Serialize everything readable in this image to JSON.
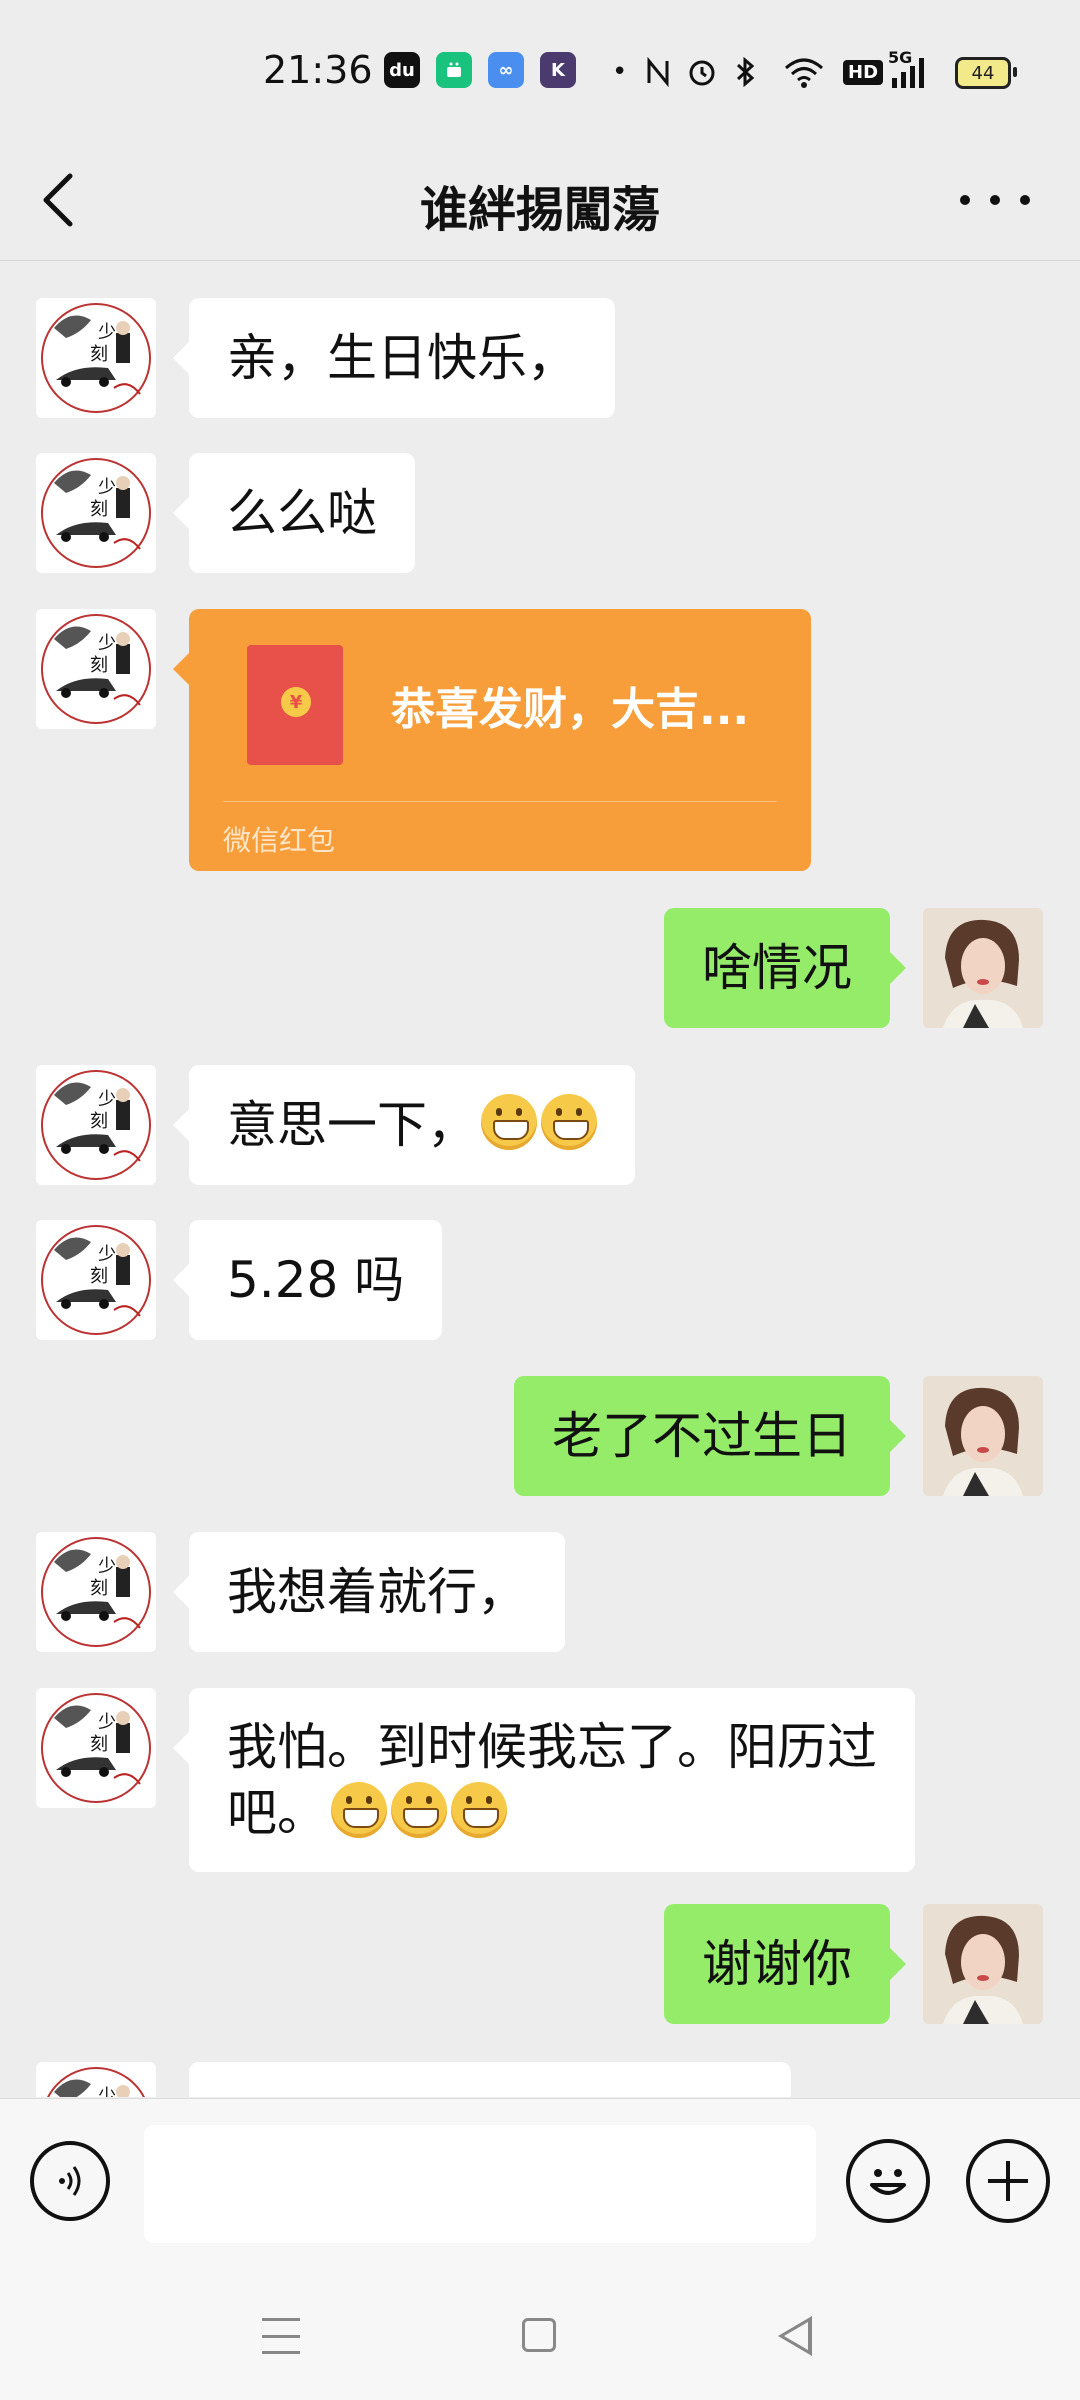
{
  "status_bar": {
    "time": "21:36",
    "app_icons": [
      {
        "name": "dewu-app-icon",
        "label": "du",
        "color": "#111111"
      },
      {
        "name": "android-app-icon",
        "label": "",
        "color": "#19c37d"
      },
      {
        "name": "infinity-app-icon",
        "label": "∞",
        "color": "#4a8ef0"
      },
      {
        "name": "k-app-icon",
        "label": "K",
        "color": "#4b3a6e"
      }
    ],
    "network": "5G",
    "hd_label": "HD",
    "battery": "44"
  },
  "header": {
    "title": "谁絆掦闖蕩"
  },
  "messages": [
    {
      "side": "in",
      "type": "text",
      "text": "亲，生日快乐，",
      "emoji_count": 0
    },
    {
      "side": "in",
      "type": "text",
      "text": "么么哒",
      "emoji_count": 0
    },
    {
      "side": "in",
      "type": "red_packet",
      "title": "恭喜发财，大吉...",
      "label": "微信红包"
    },
    {
      "side": "out",
      "type": "text",
      "text": "啥情况",
      "emoji_count": 0
    },
    {
      "side": "in",
      "type": "text",
      "text": "意思一下，",
      "emoji_count": 2
    },
    {
      "side": "in",
      "type": "text",
      "text": "5.28 吗",
      "emoji_count": 0
    },
    {
      "side": "out",
      "type": "text",
      "text": "老了不过生日",
      "emoji_count": 0
    },
    {
      "side": "in",
      "type": "text",
      "text": "我想着就行，",
      "emoji_count": 0
    },
    {
      "side": "in",
      "type": "text",
      "text": "我怕。到时候我忘了。阳历过",
      "text2": "吧。",
      "emoji_count": 3
    },
    {
      "side": "out",
      "type": "text",
      "text": "谢谢你",
      "emoji_count": 0
    }
  ],
  "avatar_left_caption": "少 刻",
  "coin_symbol": "¥",
  "colors": {
    "background": "#ededed",
    "incoming_bubble": "#ffffff",
    "outgoing_bubble": "#95ec69",
    "red_packet": "#f79e3a"
  }
}
